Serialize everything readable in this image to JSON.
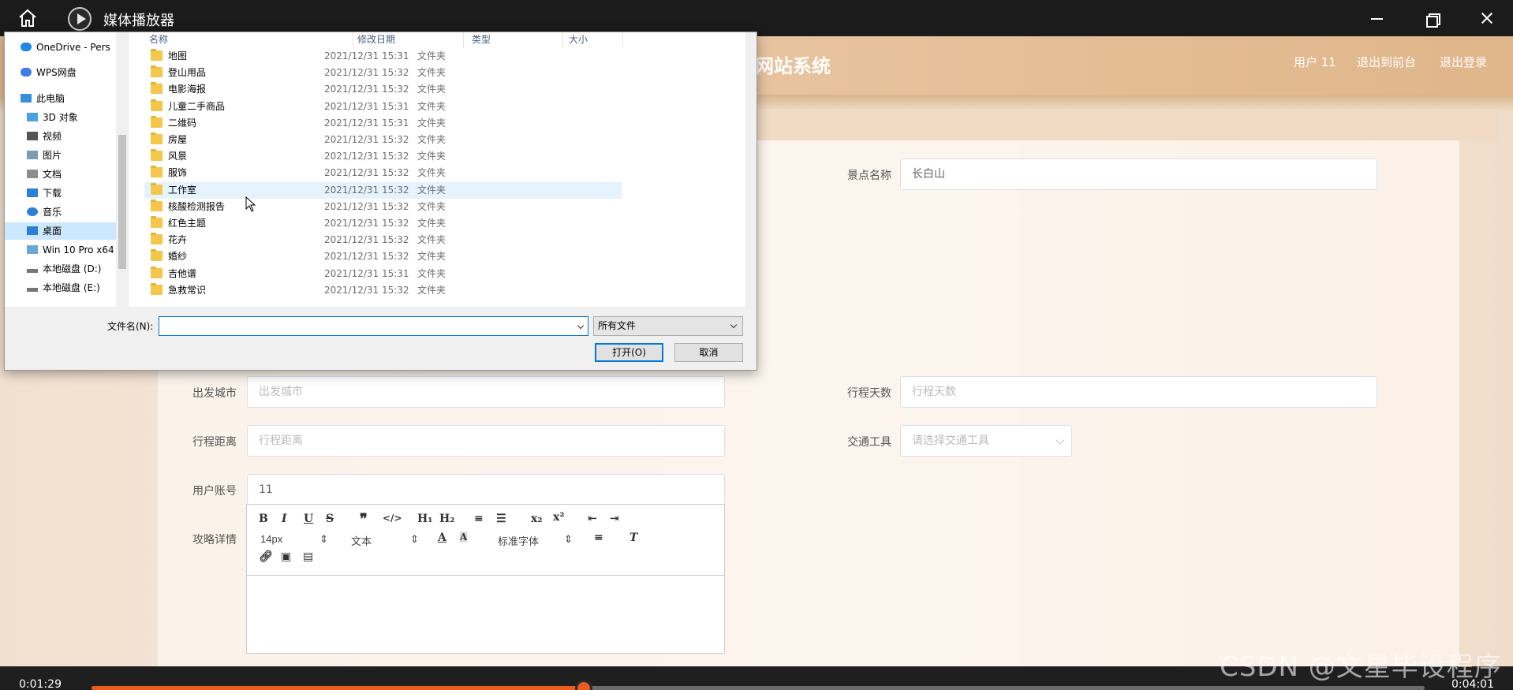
{
  "player": {
    "title": "媒体播放器",
    "time_current": "0:01:29",
    "time_total": "0:04:01",
    "progress": 0.3693,
    "accent": "#e85d1b"
  },
  "web": {
    "title": "旅游网站系统",
    "title_visible": "网站系统",
    "user": "用户 11",
    "to_front": "退出到前台",
    "logout": "退出登录",
    "labels": {
      "scenic": "景点名称",
      "depart_city": "出发城市",
      "days": "行程天数",
      "distance": "行程距离",
      "transport": "交通工具",
      "account": "用户账号",
      "detail": "攻略详情"
    },
    "values": {
      "scenic": "长白山",
      "account": "11"
    },
    "placeholders": {
      "depart_city": "出发城市",
      "days": "行程天数",
      "distance": "行程距离",
      "transport": "请选择交通工具"
    },
    "editor": {
      "font_size": "14px",
      "block": "文本",
      "font": "标准字体"
    }
  },
  "dialog": {
    "nav": [
      {
        "label": "OneDrive - Pers",
        "icon": "cloud-icon"
      },
      {
        "label": "WPS网盘",
        "icon": "cloud-icon"
      },
      {
        "label": "此电脑",
        "icon": "computer-icon"
      },
      {
        "label": "3D 对象",
        "icon": "cube-icon"
      },
      {
        "label": "视频",
        "icon": "video-icon"
      },
      {
        "label": "图片",
        "icon": "picture-icon"
      },
      {
        "label": "文档",
        "icon": "document-icon"
      },
      {
        "label": "下载",
        "icon": "download-icon"
      },
      {
        "label": "音乐",
        "icon": "music-icon"
      },
      {
        "label": "桌面",
        "icon": "desktop-icon"
      },
      {
        "label": "Win 10 Pro x64",
        "icon": "drive-icon"
      },
      {
        "label": "本地磁盘 (D:)",
        "icon": "drive-icon"
      },
      {
        "label": "本地磁盘 (E:)",
        "icon": "drive-icon"
      }
    ],
    "columns": [
      "名称",
      "修改日期",
      "类型",
      "大小"
    ],
    "rows": [
      {
        "name": "地图",
        "date": "2021/12/31 15:31",
        "type": "文件夹"
      },
      {
        "name": "登山用品",
        "date": "2021/12/31 15:32",
        "type": "文件夹"
      },
      {
        "name": "电影海报",
        "date": "2021/12/31 15:32",
        "type": "文件夹"
      },
      {
        "name": "儿童二手商品",
        "date": "2021/12/31 15:31",
        "type": "文件夹"
      },
      {
        "name": "二维码",
        "date": "2021/12/31 15:31",
        "type": "文件夹"
      },
      {
        "name": "房屋",
        "date": "2021/12/31 15:32",
        "type": "文件夹"
      },
      {
        "name": "风景",
        "date": "2021/12/31 15:32",
        "type": "文件夹"
      },
      {
        "name": "服饰",
        "date": "2021/12/31 15:32",
        "type": "文件夹"
      },
      {
        "name": "工作室",
        "date": "2021/12/31 15:32",
        "type": "文件夹"
      },
      {
        "name": "核酸检测报告",
        "date": "2021/12/31 15:32",
        "type": "文件夹"
      },
      {
        "name": "红色主题",
        "date": "2021/12/31 15:32",
        "type": "文件夹"
      },
      {
        "name": "花卉",
        "date": "2021/12/31 15:32",
        "type": "文件夹"
      },
      {
        "name": "婚纱",
        "date": "2021/12/31 15:32",
        "type": "文件夹"
      },
      {
        "name": "吉他谱",
        "date": "2021/12/31 15:31",
        "type": "文件夹"
      },
      {
        "name": "急救常识",
        "date": "2021/12/31 15:32",
        "type": "文件夹"
      }
    ],
    "filename_label": "文件名(N):",
    "filename_value": "",
    "filetype": "所有文件",
    "open_btn": "打开(O)",
    "cancel_btn": "取消"
  },
  "watermark": "CSDN @文星毕设程序"
}
